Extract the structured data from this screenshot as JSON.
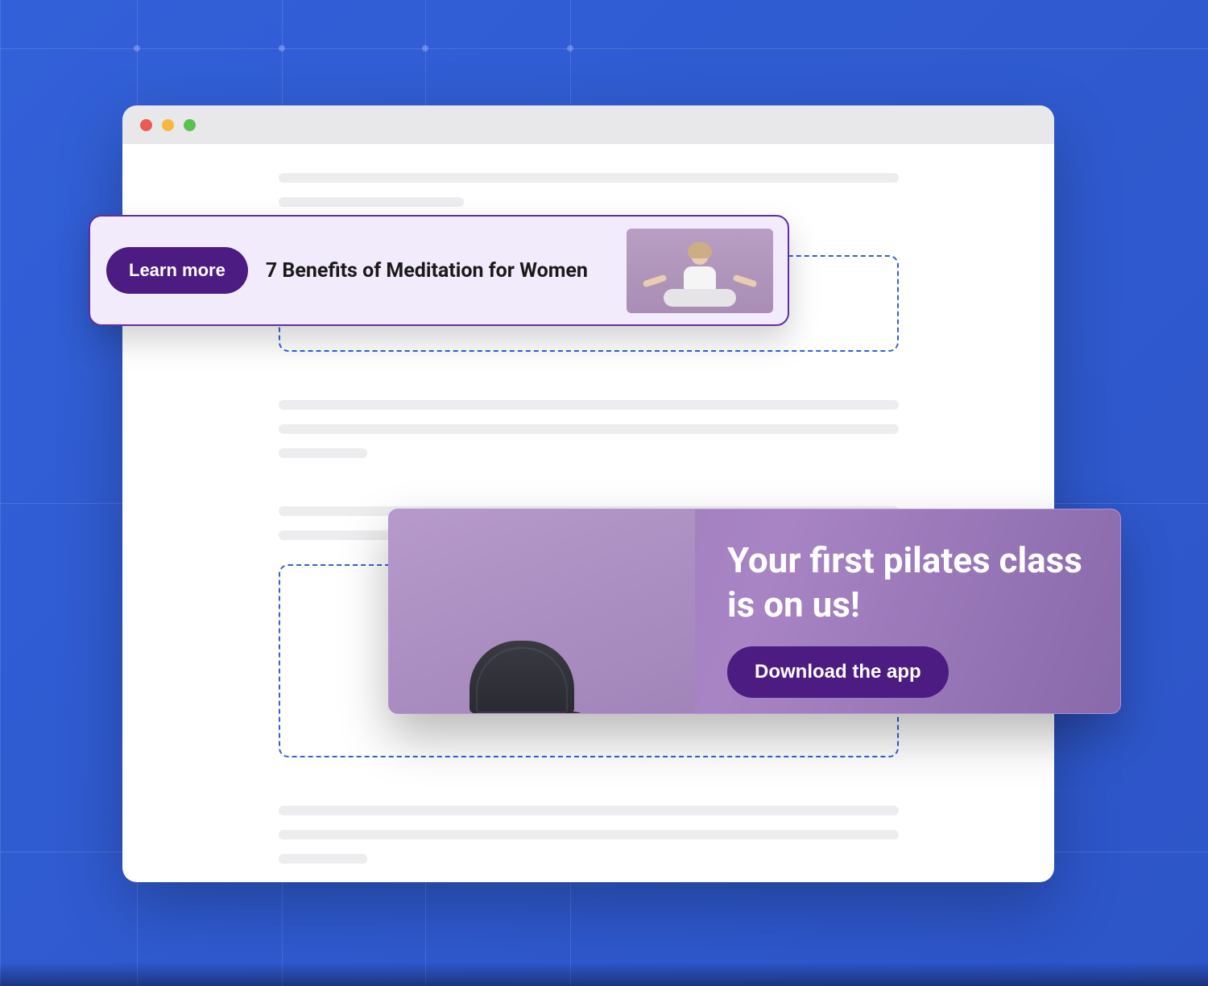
{
  "meditation_card": {
    "button_label": "Learn more",
    "title": "7 Benefits of Meditation for Women"
  },
  "pilates_card": {
    "headline": "Your first pilates class is on us!",
    "button_label": "Download the app"
  }
}
